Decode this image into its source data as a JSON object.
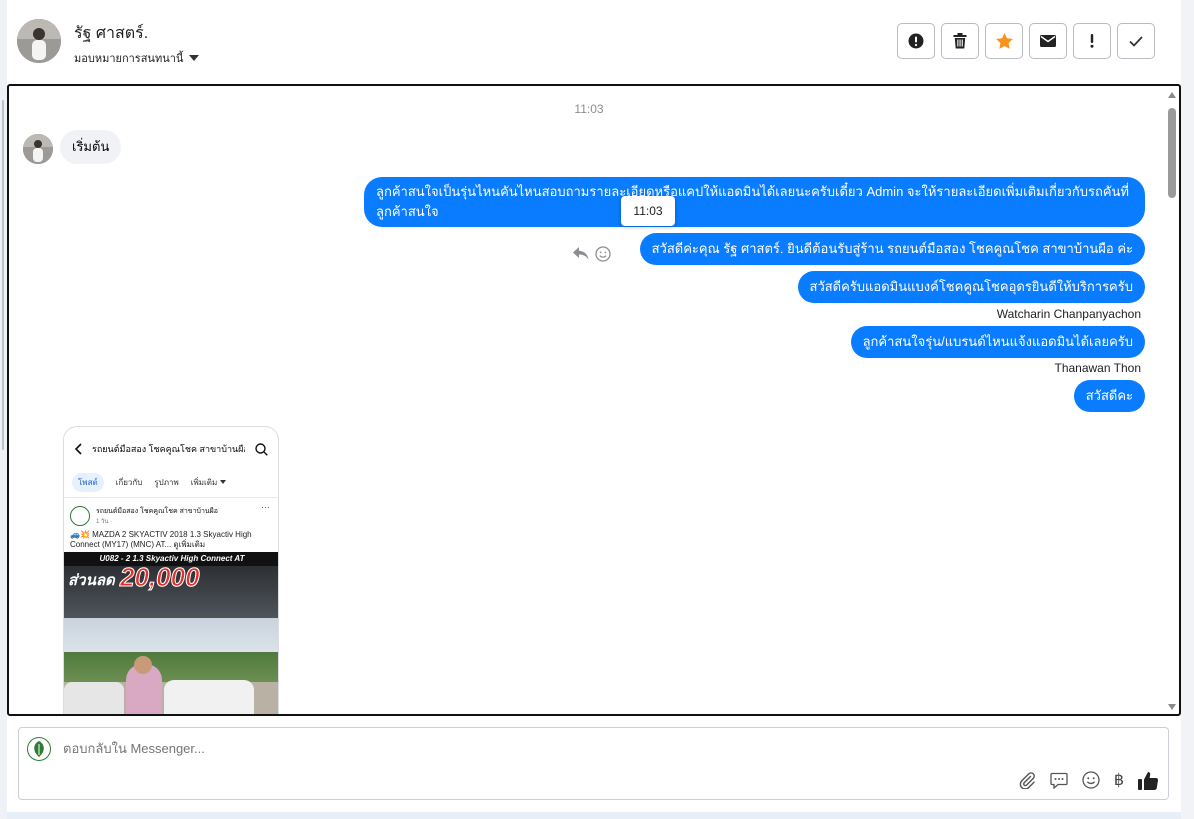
{
  "header": {
    "contact_name": "รัฐ ศาสตร์.",
    "assign_label": "มอบหมายการสนทนานี้",
    "actions": [
      {
        "name": "mark-spam-button",
        "icon": "exclamation-circle-icon"
      },
      {
        "name": "delete-button",
        "icon": "trash-icon"
      },
      {
        "name": "star-button",
        "icon": "star-icon",
        "color": "#f7931e"
      },
      {
        "name": "mark-unread-button",
        "icon": "envelope-icon"
      },
      {
        "name": "follow-up-button",
        "icon": "exclamation-icon"
      },
      {
        "name": "mark-done-button",
        "icon": "check-icon"
      }
    ]
  },
  "conversation": {
    "timestamp": "11:03",
    "incoming": {
      "text": "เริ่มต้น"
    },
    "outgoing": [
      {
        "text": "ลูกค้าสนใจเป็นรุ่นไหนคันไหนสอบถามรายละเอียดหรือแคปให้แอดมินได้เลยนะครับเดี๋ยว Admin จะให้รายละเอียดเพิ่มเติมเกี่ยวกับรถคันที่ลูกค้าสนใจ"
      },
      {
        "text": "สวัสดีค่ะคุณ รัฐ ศาสตร์. ยินดีต้อนรับสู่ร้าน รถยนต์มือสอง โชคคูณโชค สาขาบ้านผือ ค่ะ"
      },
      {
        "text": "สวัสดีครับแอดมินแบงค์โชคคูณโชคอุดรยินดีให้บริการครับ",
        "sender": "Watcharin Chanpanyachon"
      },
      {
        "text": "ลูกค้าสนใจรุ่น/แบรนด์ไหนแจ้งแอดมินได้เลยครับ",
        "sender": "Thanawan Thon"
      },
      {
        "text": "สวัสดีคะ"
      }
    ],
    "tooltip": "11:03",
    "shared_card": {
      "page_title": "รถยนต์มือสอง โชคคูณโชค สาขาบ้านผือ",
      "tabs": [
        "โพสต์",
        "เกี่ยวกับ",
        "รูปภาพ",
        "เพิ่มเติม"
      ],
      "post_author": "รถยนต์มือสอง โชคคูณโชค สาขาบ้านผือ",
      "post_meta": "1 วัน · ",
      "post_text": "🚙💥 MAZDA 2 SKYACTIV 2018 1.3 Skyactiv High Connect (MY17) (MNC) AT... ดูเพิ่มเติม",
      "photo_banner": "U082 - 2 1.3 Skyactiv High Connect AT",
      "discount_label": "ส่วนลด",
      "discount_value": "20,000"
    }
  },
  "composer": {
    "placeholder": "ตอบกลับใน Messenger..."
  },
  "colors": {
    "accent": "#0a7cff",
    "star": "#f7931e",
    "incoming_bg": "#f0f2f5"
  }
}
